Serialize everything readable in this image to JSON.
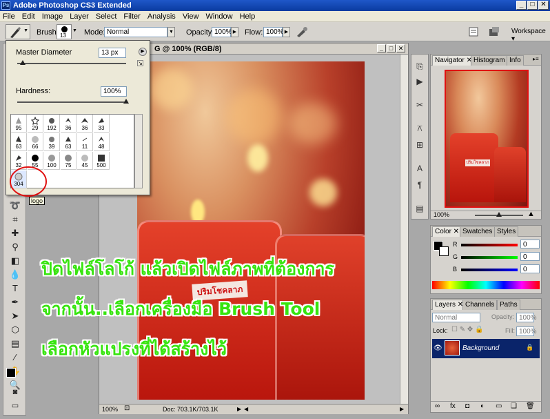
{
  "window": {
    "title": "Adobe Photoshop CS3 Extended",
    "app_icon": "Ps",
    "controls": [
      "_",
      "□",
      "✕"
    ]
  },
  "menu": [
    "File",
    "Edit",
    "Image",
    "Layer",
    "Select",
    "Filter",
    "Analysis",
    "View",
    "Window",
    "Help"
  ],
  "options": {
    "brush_label": "Brush:",
    "brush_size": "13",
    "mode_label": "Mode:",
    "mode_value": "Normal",
    "opacity_label": "Opacity:",
    "opacity_value": "100%",
    "flow_label": "Flow:",
    "flow_value": "100%",
    "workspace_label": "Workspace ▾"
  },
  "brush_picker": {
    "master_diameter_label": "Master Diameter",
    "master_diameter_value": "13 px",
    "hardness_label": "Hardness:",
    "hardness_value": "100%",
    "brushes": [
      "95",
      "29",
      "192",
      "36",
      "36",
      "33",
      "63",
      "66",
      "39",
      "63",
      "11",
      "48",
      "32",
      "55",
      "100",
      "75",
      "45",
      "500",
      "304"
    ],
    "tooltip": "logo"
  },
  "document": {
    "title": "G @ 100% (RGB/8)",
    "zoom": "100%",
    "doc_size": "Doc: 703.1K/703.1K",
    "photo_label_thai": "ปริมโชคลาภ"
  },
  "overlay": {
    "line1": "ปิดไฟล์โลโก้ แล้วเปิดไฟล์ภาพที่ต้องการ",
    "line2": "จากนั้น..เลือกเครื่องมือ Brush Tool",
    "line3": "เลือกหัวแปรงที่ได้สร้างไว้"
  },
  "navigator": {
    "tabs": [
      "Navigator",
      "Histogram",
      "Info"
    ],
    "zoom": "100%",
    "thumb_label_thai": "ปริมโชคลาภ"
  },
  "color_panel": {
    "tabs": [
      "Color",
      "Swatches",
      "Styles"
    ],
    "channels": [
      {
        "label": "R",
        "value": "0",
        "color": "#c00000"
      },
      {
        "label": "G",
        "value": "0",
        "color": "#00a000"
      },
      {
        "label": "B",
        "value": "0",
        "color": "#0000c0"
      }
    ]
  },
  "layers_panel": {
    "tabs": [
      "Layers",
      "Channels",
      "Paths"
    ],
    "blend_mode": "Normal",
    "opacity_label": "Opacity:",
    "opacity_value": "100%",
    "lock_label": "Lock:",
    "fill_label": "Fill:",
    "fill_value": "100%",
    "layer_name": "Background",
    "footer_icons": [
      "link-icon",
      "fx-icon",
      "mask-icon",
      "adjustment-icon",
      "group-icon",
      "new-layer-icon",
      "trash-icon"
    ]
  },
  "colors": {
    "overlay_green": "#37e40f",
    "layer_selected": "#0a246a",
    "circle_red": "#e01010"
  }
}
